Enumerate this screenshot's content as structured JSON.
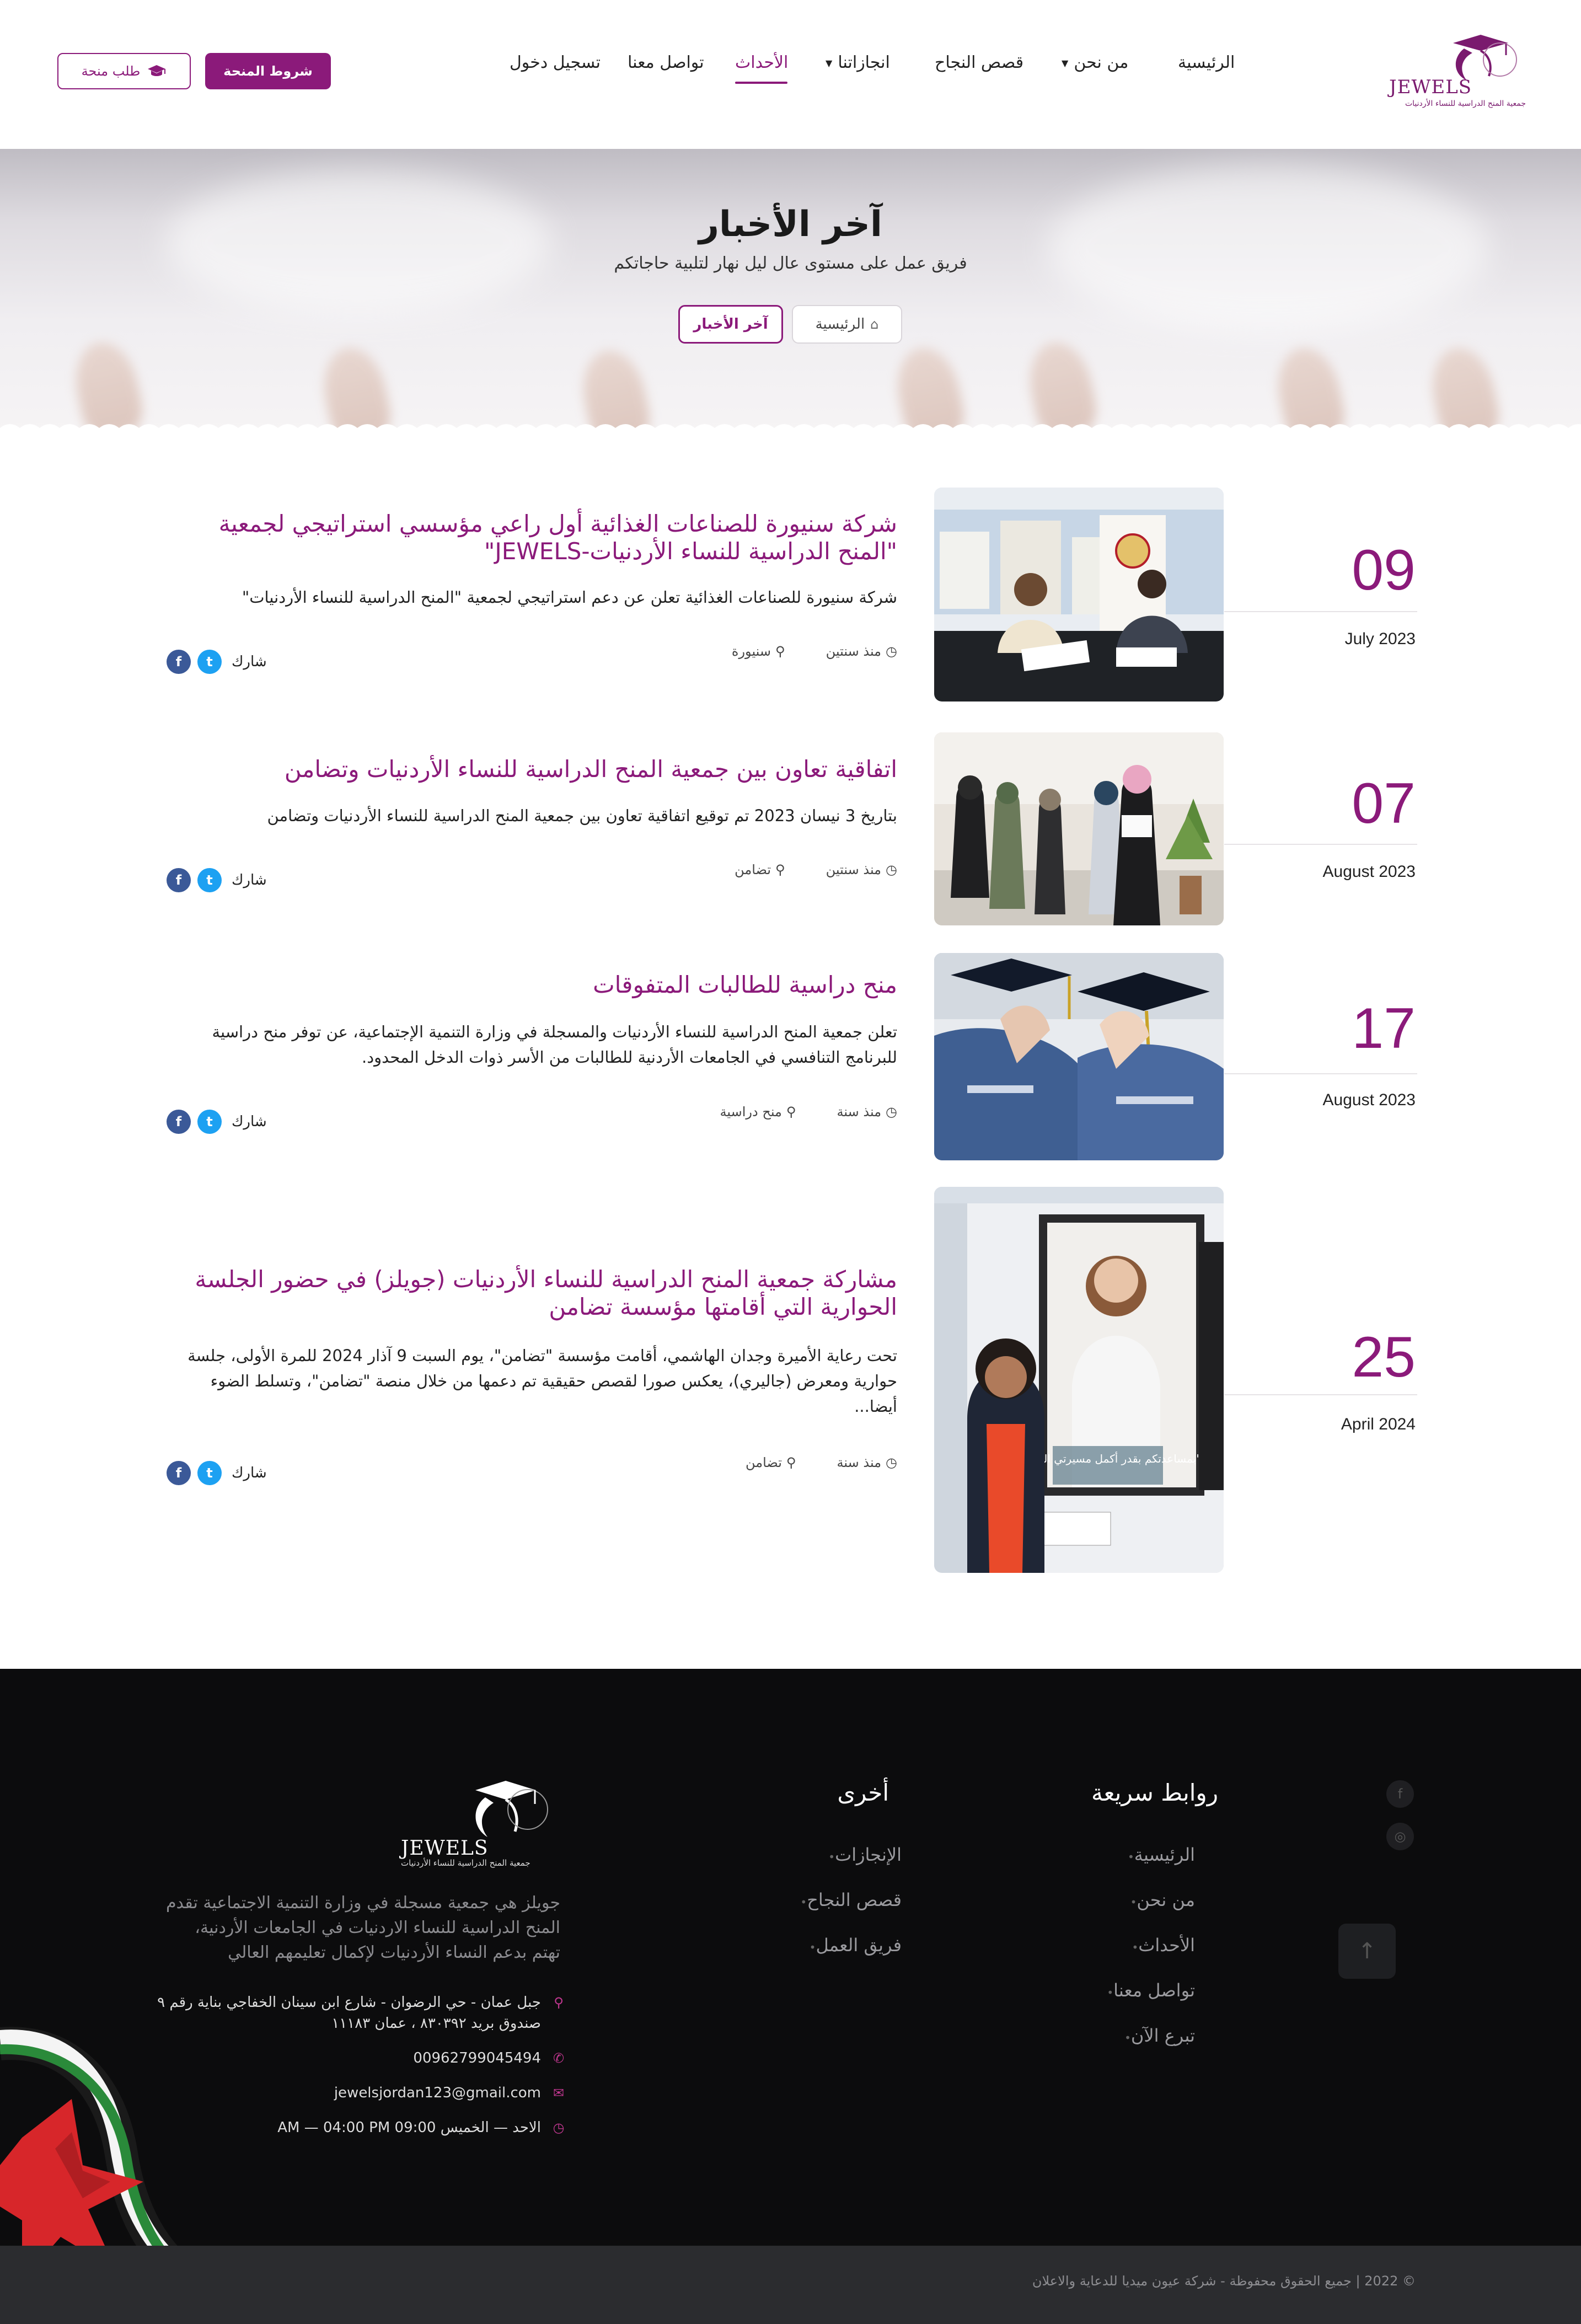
{
  "header": {
    "logo": {
      "brand": "JEWELS",
      "subtitle": "جمعية المنح الدراسية للنساء الأردنيات"
    },
    "nav": [
      {
        "label": "الرئيسية",
        "caret": false,
        "active": false
      },
      {
        "label": "من نحن",
        "caret": true,
        "active": false
      },
      {
        "label": "قصص النجاح",
        "caret": false,
        "active": false
      },
      {
        "label": "انجازاتنا",
        "caret": true,
        "active": false
      },
      {
        "label": "الأحداث",
        "caret": false,
        "active": true
      },
      {
        "label": "تواصل معنا",
        "caret": false,
        "active": false
      },
      {
        "label": "تسجيل دخول",
        "caret": false,
        "active": false
      }
    ],
    "terms_button": "شروط المنحة",
    "apply_button": "طلب منحة"
  },
  "hero": {
    "title": "آخر الأخبار",
    "subtitle": "فريق عمل على مستوى عال ليل نهار لتلبية حاجاتكم",
    "breadcrumb_home": "الرئيسية",
    "breadcrumb_current": "آخر الأخبار"
  },
  "news": [
    {
      "day": "09",
      "month": "July 2023",
      "title": "شركة سنيورة للصناعات الغذائية أول راعي مؤسسي استراتيجي لجمعية \"المنح الدراسية للنساء الأردنيات-JEWELS\"",
      "excerpt": "شركة سنيورة للصناعات الغذائية تعلن عن دعم استراتيجي لجمعية \"المنح الدراسية للنساء الأردنيات\"",
      "time": "منذ سنتين",
      "location": "سنيورة",
      "share": "شارك"
    },
    {
      "day": "07",
      "month": "August 2023",
      "title": "اتفاقية تعاون بين جمعية المنح الدراسية للنساء الأردنيات وتضامن",
      "excerpt": "بتاريخ 3 نيسان 2023 تم توقيع اتفاقية تعاون بين جمعية المنح الدراسية للنساء الأردنيات وتضامن",
      "time": "منذ سنتين",
      "location": "تضامن",
      "share": "شارك"
    },
    {
      "day": "17",
      "month": "August 2023",
      "title": "منح دراسية للطالبات المتفوقات",
      "excerpt": "تعلن جمعية المنح الدراسية للنساء الأردنيات والمسجلة في وزارة التنمية الإجتماعية، عن توفر منح دراسية للبرنامج التنافسي في الجامعات الأردنية للطالبات من الأسر ذوات الدخل المحدود.",
      "time": "منذ سنة",
      "location": "منح دراسية",
      "share": "شارك"
    },
    {
      "day": "25",
      "month": "April 2024",
      "title": "مشاركة جمعية المنح الدراسية للنساء الأردنيات (جويلز) في حضور الجلسة الحوارية التي أقامتها مؤسسة تضامن",
      "excerpt": "تحت رعاية الأميرة وجدان الهاشمي، أقامت مؤسسة \"تضامن\"، يوم السبت 9 آذار 2024 للمرة الأولى، جلسة حوارية ومعرض (جاليري)، يعكس صورا لقصص حقيقية تم دعمها من خلال منصة \"تضامن\"، وتسلط الضوء أيضا...",
      "time": "منذ سنة",
      "location": "تضامن",
      "share": "شارك",
      "poster_text": "\"بمساعدتكم بقدر أكمل مسيرتي العلمية\""
    }
  ],
  "footer": {
    "quick_links_title": "روابط سريعة",
    "quick_links": [
      "الرئيسية",
      "من نحن",
      "الأحداث",
      "تواصل معنا",
      "تبرع الآن"
    ],
    "other_title": "أخرى",
    "other_links": [
      "الإنجازات",
      "قصص النجاح",
      "فريق العمل"
    ],
    "logo": {
      "brand": "JEWELS",
      "subtitle": "جمعية المنح الدراسية للنساء الأردنيات"
    },
    "about": "جويلز هي جمعية مسجلة في وزارة التنمية الاجتماعية تقدم المنح الدراسية للنساء الاردنيات في الجامعات الأردنية، تهتم بدعم النساء الأردنيات لإكمال تعليمهم العالي",
    "address": "جبل عمان - حي الرضوان - شارع ابن سينان الخفاجي بناية رقم ٩ صندوق بريد ٨٣٠٣٩٢ ، عمان ١١١٨٣",
    "phone": "00962799045494",
    "email": "jewelsjordan123@gmail.com",
    "hours": "الاحد — الخميس 09:00 AM — 04:00 PM",
    "copyright": "© 2022 | جميع الحقوق محفوظة - شركة عيون ميديا للدعاية والاعلان"
  },
  "colors": {
    "brand": "#8b1a7a",
    "footer_bg": "#0c0c0d",
    "copy_bar": "#2b2c2f"
  }
}
